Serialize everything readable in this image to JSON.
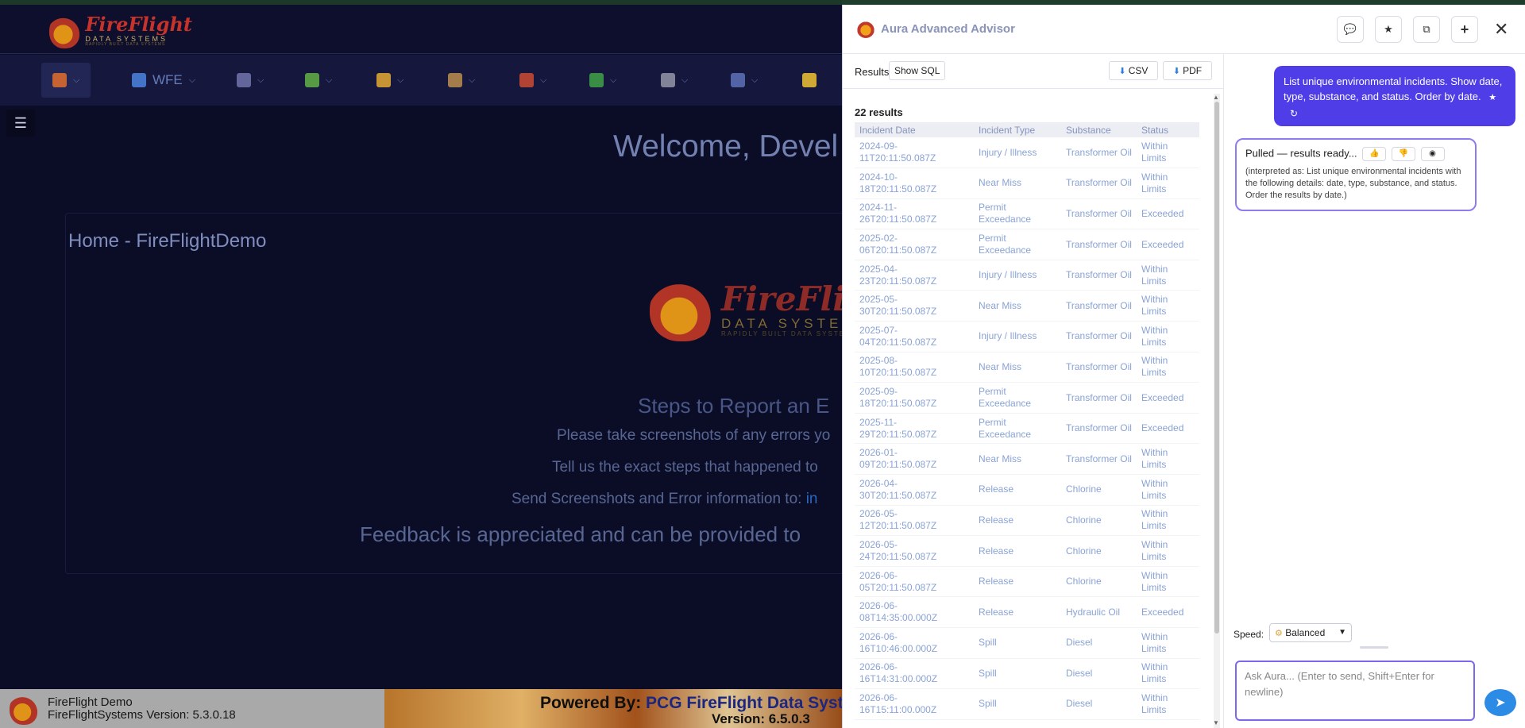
{
  "app": {
    "logo_line1": "FireFlight",
    "logo_line2": "DATA SYSTEMS",
    "logo_line3": "RAPIDLY BUILT DATA SYSTEMS",
    "nav": [
      {
        "label": "",
        "icon": "home-icon"
      },
      {
        "label": "WFE",
        "icon": "workflow-icon"
      },
      {
        "label": "",
        "icon": "document-icon"
      },
      {
        "label": "",
        "icon": "puzzle-icon"
      },
      {
        "label": "",
        "icon": "truck-icon"
      },
      {
        "label": "",
        "icon": "box-icon"
      },
      {
        "label": "",
        "icon": "brick-icon"
      },
      {
        "label": "",
        "icon": "leaf-icon"
      },
      {
        "label": "",
        "icon": "report-icon"
      },
      {
        "label": "",
        "icon": "search-icon"
      },
      {
        "label": "",
        "icon": "lightbulb-icon"
      }
    ],
    "welcome": "Welcome, Devel",
    "home_title": "Home - FireFlightDemo",
    "steps_title": "Steps to Report an E",
    "steps_line1": "Please take screenshots of any errors yo",
    "steps_line2": "Tell us the exact steps that happened to",
    "steps_line3": "Send Screenshots and Error information to:",
    "steps_line3_link": "in",
    "feedback": "Feedback is appreciated and can be provided to",
    "footer_name": "FireFlight Demo",
    "footer_version": "FireFlightSystems Version: 5.3.0.18",
    "powered_prefix": "Powered By:",
    "powered_name": "PCG FireFlight Data Syst",
    "powered_version": "Version: 6.5.0.3"
  },
  "panel": {
    "title": "Aura Advanced Advisor",
    "tabs_results": "Results",
    "show_sql": "Show SQL",
    "csv": "CSV",
    "pdf": "PDF",
    "result_count": "22 results",
    "columns": [
      "Incident Date",
      "Incident Type",
      "Substance",
      "Status"
    ],
    "rows": [
      [
        "2024-09-11T20:11:50.087Z",
        "Injury / Illness",
        "Transformer Oil",
        "Within Limits"
      ],
      [
        "2024-10-18T20:11:50.087Z",
        "Near Miss",
        "Transformer Oil",
        "Within Limits"
      ],
      [
        "2024-11-26T20:11:50.087Z",
        "Permit Exceedance",
        "Transformer Oil",
        "Exceeded"
      ],
      [
        "2025-02-06T20:11:50.087Z",
        "Permit Exceedance",
        "Transformer Oil",
        "Exceeded"
      ],
      [
        "2025-04-23T20:11:50.087Z",
        "Injury / Illness",
        "Transformer Oil",
        "Within Limits"
      ],
      [
        "2025-05-30T20:11:50.087Z",
        "Near Miss",
        "Transformer Oil",
        "Within Limits"
      ],
      [
        "2025-07-04T20:11:50.087Z",
        "Injury / Illness",
        "Transformer Oil",
        "Within Limits"
      ],
      [
        "2025-08-10T20:11:50.087Z",
        "Near Miss",
        "Transformer Oil",
        "Within Limits"
      ],
      [
        "2025-09-18T20:11:50.087Z",
        "Permit Exceedance",
        "Transformer Oil",
        "Exceeded"
      ],
      [
        "2025-11-29T20:11:50.087Z",
        "Permit Exceedance",
        "Transformer Oil",
        "Exceeded"
      ],
      [
        "2026-01-09T20:11:50.087Z",
        "Near Miss",
        "Transformer Oil",
        "Within Limits"
      ],
      [
        "2026-04-30T20:11:50.087Z",
        "Release",
        "Chlorine",
        "Within Limits"
      ],
      [
        "2026-05-12T20:11:50.087Z",
        "Release",
        "Chlorine",
        "Within Limits"
      ],
      [
        "2026-05-24T20:11:50.087Z",
        "Release",
        "Chlorine",
        "Within Limits"
      ],
      [
        "2026-06-05T20:11:50.087Z",
        "Release",
        "Chlorine",
        "Within Limits"
      ],
      [
        "2026-06-08T14:35:00.000Z",
        "Release",
        "Hydraulic Oil",
        "Exceeded"
      ],
      [
        "2026-06-16T10:46:00.000Z",
        "Spill",
        "Diesel",
        "Within Limits"
      ],
      [
        "2026-06-16T14:31:00.000Z",
        "Spill",
        "Diesel",
        "Within Limits"
      ],
      [
        "2026-06-16T15:11:00.000Z",
        "Spill",
        "Diesel",
        "Within Limits"
      ],
      [
        "2026-06-",
        "",
        "",
        "Within"
      ]
    ],
    "user_message": "List unique environmental incidents. Show date, type, substance, and status. Order by date.",
    "bot_status": "Pulled — results ready...",
    "bot_interpretation": "(interpreted as: List unique environmental incidents with the following details: date, type, substance, and status. Order the results by date.)",
    "speed_label": "Speed:",
    "speed_value": "Balanced",
    "input_placeholder": "Ask Aura...  (Enter to send, Shift+Enter for newline)"
  }
}
